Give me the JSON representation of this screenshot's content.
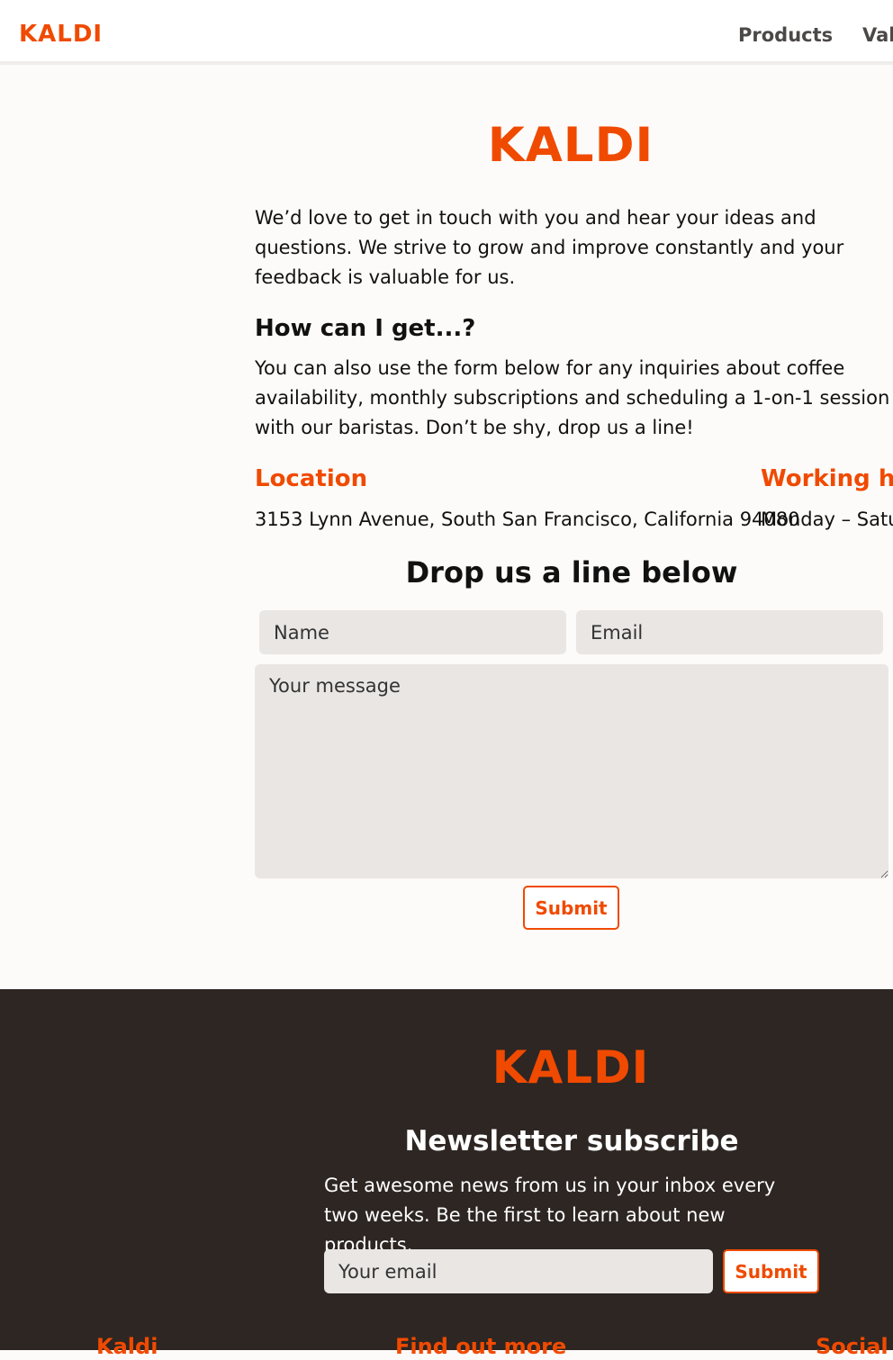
{
  "nav": {
    "logo": "KALDI",
    "links": [
      "Products",
      "Val"
    ]
  },
  "hero": {
    "logo": "KALDI",
    "intro": "We’d love to get in touch with you and hear your ideas and questions. We strive to grow and improve constantly and your feedback is valuable for us.",
    "question_heading": "How can I get...?",
    "question_text": "You can also use the form below for any inquiries about coffee availability, monthly subscriptions and scheduling a 1-on-1 session with our baristas. Don’t be shy, drop us a line!"
  },
  "contact_info": {
    "location_heading": "Location",
    "location_value": "3153 Lynn Avenue, South San Francisco, California 94080",
    "hours_heading": "Working ho",
    "hours_value": "Monday – Satu"
  },
  "form": {
    "title": "Drop us a line below",
    "name_placeholder": "Name",
    "email_placeholder": "Email",
    "message_placeholder": "Your message",
    "submit_label": "Submit"
  },
  "footer": {
    "logo": "KALDI",
    "newsletter_title": "Newsletter subscribe",
    "newsletter_text": "Get awesome news from us in your inbox every two weeks. Be the first to learn about new products.",
    "email_placeholder": "Your email",
    "submit_label": "Submit",
    "columns": [
      "Kaldi",
      "Find out more",
      "Social"
    ]
  },
  "colors": {
    "accent": "#f04a00",
    "footer_bg": "#2d2623",
    "page_bg": "#fcfbf9",
    "field_bg": "#e9e6e4"
  }
}
